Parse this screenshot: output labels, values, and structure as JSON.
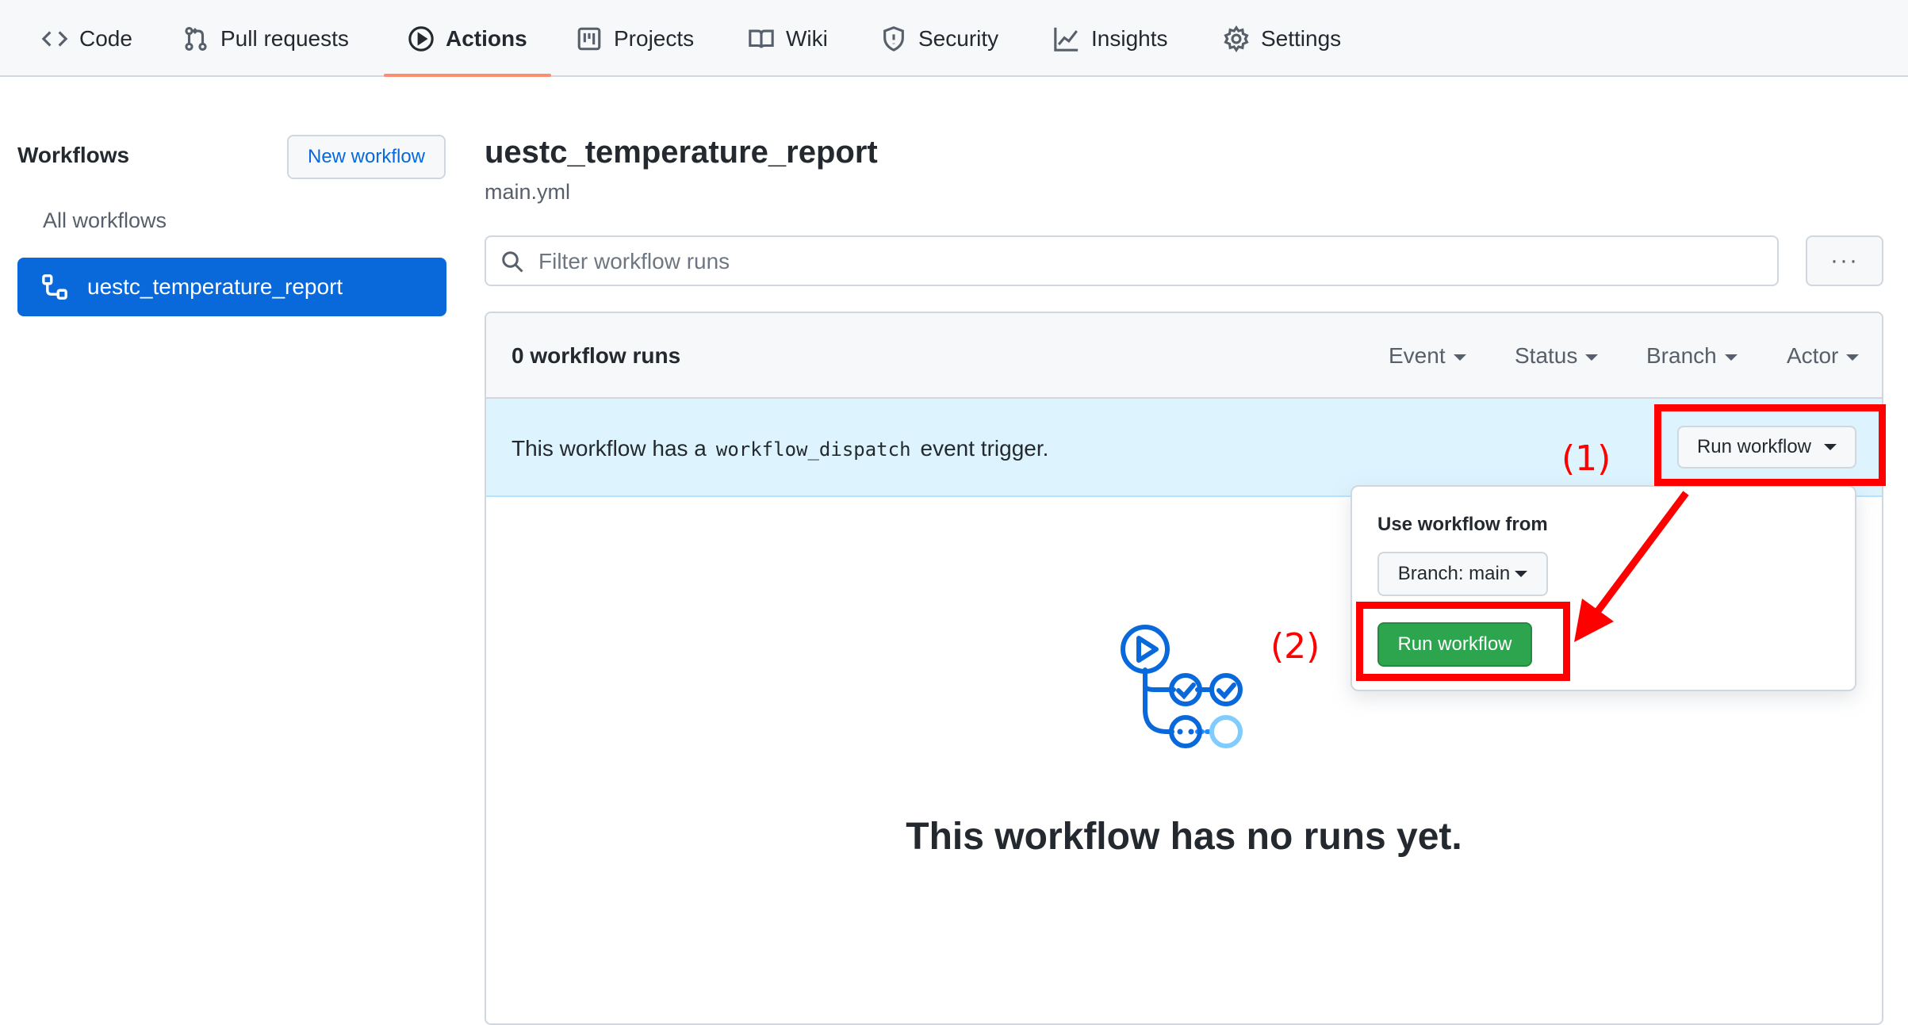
{
  "nav": {
    "tabs": [
      {
        "label": "Code",
        "icon": "code-icon"
      },
      {
        "label": "Pull requests",
        "icon": "pull-request-icon"
      },
      {
        "label": "Actions",
        "icon": "play-icon",
        "active": true
      },
      {
        "label": "Projects",
        "icon": "project-board-icon"
      },
      {
        "label": "Wiki",
        "icon": "book-icon"
      },
      {
        "label": "Security",
        "icon": "shield-icon"
      },
      {
        "label": "Insights",
        "icon": "graph-icon"
      },
      {
        "label": "Settings",
        "icon": "gear-icon"
      }
    ]
  },
  "sidebar": {
    "heading": "Workflows",
    "new_workflow_label": "New workflow",
    "all_workflows_label": "All workflows",
    "active_workflow": "uestc_temperature_report"
  },
  "main": {
    "title": "uestc_temperature_report",
    "file": "main.yml",
    "filter_placeholder": "Filter workflow runs",
    "more_label": "···",
    "runs_count": "0 workflow runs",
    "filters": [
      "Event",
      "Status",
      "Branch",
      "Actor"
    ],
    "dispatch": {
      "prefix": "This workflow has a",
      "code": "workflow_dispatch",
      "suffix": "event trigger."
    },
    "run_workflow_dropdown_label": "Run workflow",
    "popover": {
      "heading": "Use workflow from",
      "branch_label": "Branch: main",
      "run_button_label": "Run workflow"
    },
    "empty_title": "This workflow has no runs yet."
  },
  "annotations": {
    "label_1": "(1)",
    "label_2": "(2)",
    "color": "#ff0000"
  },
  "colors": {
    "accent": "#0969da",
    "tab_underline": "#fd8c73",
    "run_green": "#2da44e",
    "dispatch_bg": "#ddf4ff"
  }
}
